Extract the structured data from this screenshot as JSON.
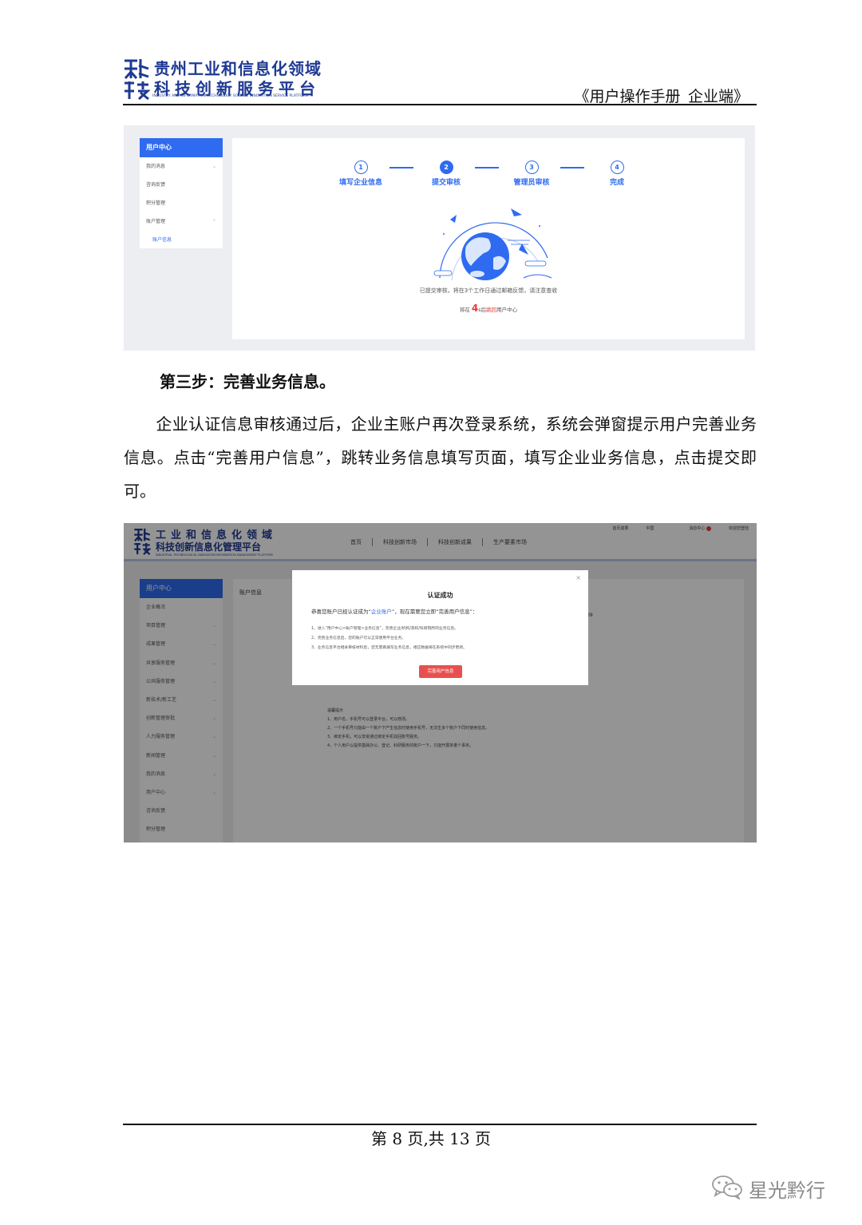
{
  "header": {
    "logo_cn_line1": "贵州工业和信息化领域",
    "logo_cn_line2": "科技创新服务平台",
    "logo_en": "INDUSTRY AND INFORMATION TECHNOLOGY SCIENCE INNOVATION SERVICE PLATFORM",
    "doc_title": "《用户操作手册_企业端》"
  },
  "screenshot1": {
    "sidebar": {
      "header": "用户中心",
      "items": [
        "我的消息",
        "咨询反馈",
        "积分管理",
        "账户管理"
      ],
      "sub_item": "账户信息"
    },
    "steps": [
      {
        "num": "1",
        "label": "填写企业信息"
      },
      {
        "num": "2",
        "label": "提交审核"
      },
      {
        "num": "3",
        "label": "管理员审核"
      },
      {
        "num": "4",
        "label": "完成"
      }
    ],
    "active_step": 2,
    "message": "已提交审核，将在3个工作日通过邮箱反馈，请注意查收",
    "countdown_prefix": "将在",
    "countdown_value": "4",
    "countdown_mid": "s后",
    "countdown_link": "跳回",
    "countdown_suffix": "用户中心"
  },
  "body": {
    "heading": "第三步：完善业务信息。",
    "paragraph": "企业认证信息审核通过后，企业主账户再次登录系统，系统会弹窗提示用户完善业务信息。点击“完善用户信息”，跳转业务信息填写页面，填写企业业务信息，点击提交即可。"
  },
  "screenshot2": {
    "logo_cn_line1": "工业和信息化领域",
    "logo_cn_line2": "科技创新信息化管理平台",
    "logo_en": "INDUSTRIAL TECHNOLOGICAL INNOVATION INFORMATION MANAGEMENT PLATFORM",
    "nav": [
      "首页",
      "科技创新市场",
      "科技创新成果",
      "生产要素市场"
    ],
    "util": [
      "首页成果",
      "中国",
      "消息中心",
      "欢迎您登陆"
    ],
    "sidebar": {
      "header": "用户中心",
      "items": [
        "企业概况",
        "项目管理",
        "成果管理",
        "共享服务管理",
        "公共服务管理",
        "新技术/新工艺",
        "创新管理审批",
        "人力服务管理",
        "新闻管理",
        "我的消息",
        "用户中心",
        "咨询反馈",
        "积分管理"
      ]
    },
    "main_title": "账户信息",
    "main_fragment": "09",
    "notice_lines": [
      "温馨提示",
      "1、用户名、手机号可以登录平台，可以修改。",
      "2、一个手机号只能由一个账户下产生信息时使用手机号，无法生多个账户下同时使用信息。",
      "3、绑定手机，可以享受通过绑定手机找回账号服务。",
      "4、个人用户以提供基础办公、登记、科研服务的账户一下，只能开展单量个事务。"
    ],
    "modal": {
      "close": "×",
      "title": "认证成功",
      "line_prefix": "恭喜您账户已经认证成为“",
      "line_highlight": "企业账户",
      "line_suffix": "”，现在需要您立即“完善用户信息”：",
      "list": [
        "1、进入“用户中心>账户管理>业务信息”，完善企业/机构/高校/科研院所的业务信息。",
        "2、完善业务信息后，您的账户可以正常使用平台业务。",
        "3、业务信息平台相关审核材料后，您无需再填写业务信息，相应数据将在系统中同步更新。"
      ],
      "button": "完善用户信息"
    }
  },
  "footer": {
    "page": "第 8 页,共 13 页",
    "watermark": "星光黔行"
  }
}
